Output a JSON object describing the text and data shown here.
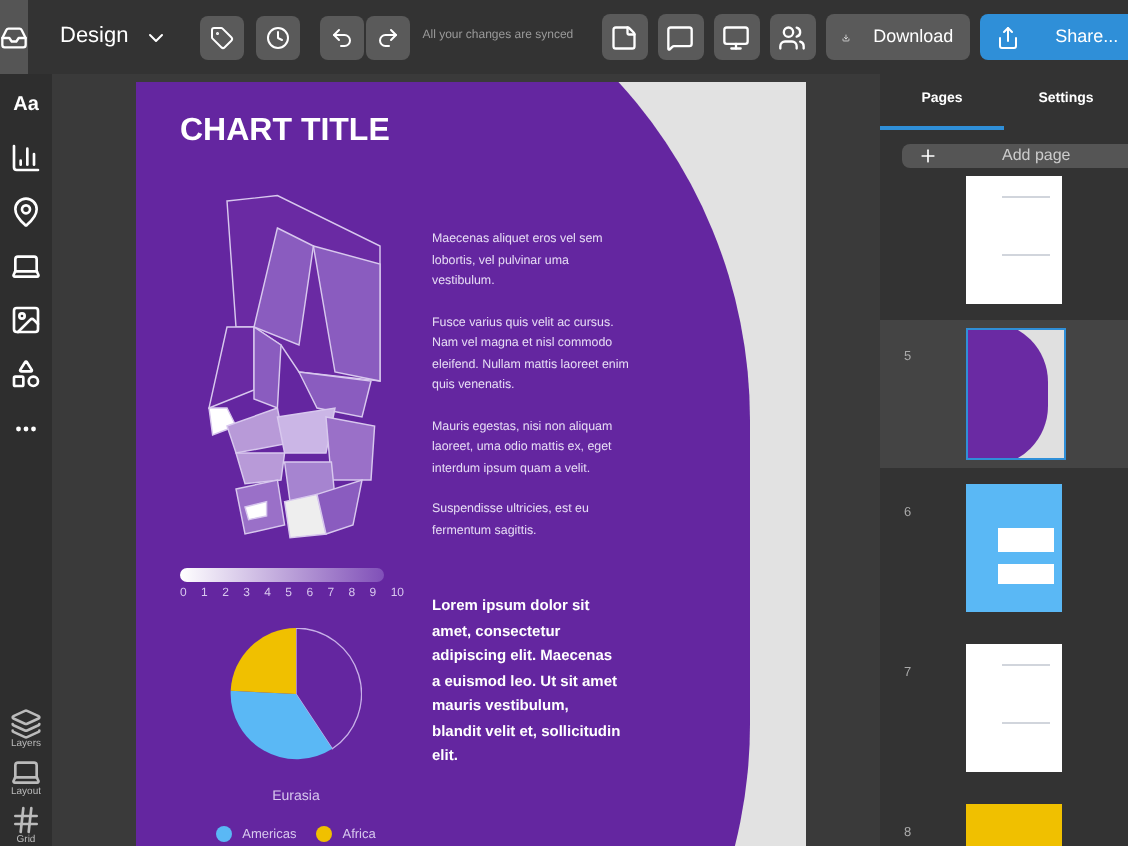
{
  "toolbar": {
    "mode": "Design",
    "sync_status": "All your changes are synced",
    "download": "Download",
    "share": "Share..."
  },
  "sidebar": {
    "tools": [
      {
        "kind": "text",
        "label": "Aa",
        "selected": false
      },
      {
        "kind": "chart",
        "selected": false
      },
      {
        "kind": "map",
        "selected": false
      },
      {
        "kind": "layout",
        "selected": false
      },
      {
        "kind": "image",
        "selected": false
      },
      {
        "kind": "shapes",
        "selected": false
      },
      {
        "kind": "more",
        "selected": false
      }
    ],
    "bottom": [
      {
        "kind": "layers",
        "label": "Layers"
      },
      {
        "kind": "layout",
        "label": "Layout"
      },
      {
        "kind": "grid",
        "label": "Grid"
      }
    ]
  },
  "page": {
    "title": "CHART TITLE",
    "paragraphs": [
      "Maecenas aliquet eros vel sem lobortis, vel pulvinar uma vestibulum.",
      "Fusce varius quis velit ac cursus. Nam vel magna et nisl commodo eleifend. Nullam mattis laoreet enim quis venenatis.",
      "Mauris egestas, nisi non aliquam laoreet, uma odio mattis ex, eget interdum ipsum quam a velit.",
      "Suspendisse ultricies, est eu fermentum sagittis."
    ],
    "scale_labels": [
      "0",
      "1",
      "2",
      "3",
      "4",
      "5",
      "6",
      "7",
      "8",
      "9",
      "10"
    ],
    "bold_text": "Lorem ipsum dolor sit amet, consectetur adipiscing elit. Maecenas a euismod leo. Ut sit amet mauris vestibulum, blandit velit et, sollicitudin elit.",
    "pie_label": "Eurasia",
    "legend": [
      {
        "label": "Americas",
        "color": "#5ab8f5"
      },
      {
        "label": "Africa",
        "color": "#f0c000"
      }
    ]
  },
  "panel": {
    "tabs": [
      {
        "label": "Pages",
        "selected": true
      },
      {
        "label": "Settings",
        "selected": false
      }
    ],
    "add_page": "Add page",
    "pages": [
      {
        "kind": "white",
        "selected": false
      },
      {
        "number": "5",
        "kind": "purple",
        "selected": true
      },
      {
        "number": "6",
        "kind": "blue",
        "selected": false
      },
      {
        "number": "7",
        "kind": "white",
        "selected": false
      },
      {
        "number": "8",
        "kind": "yellow",
        "selected": false
      }
    ]
  }
}
